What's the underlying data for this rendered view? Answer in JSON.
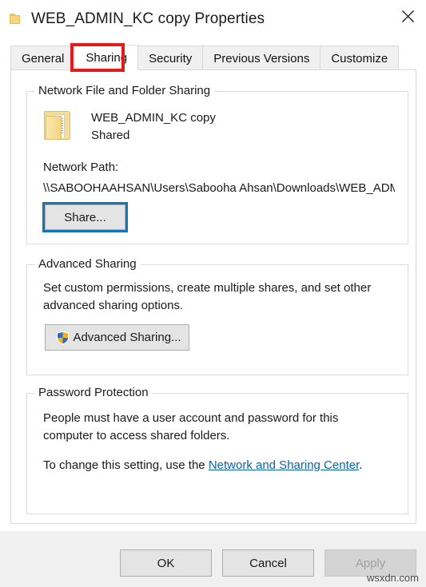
{
  "window": {
    "title": "WEB_ADMIN_KC copy Properties",
    "icon": "folder-icon",
    "close_label": "×"
  },
  "tabs": [
    {
      "label": "General",
      "active": false
    },
    {
      "label": "Sharing",
      "active": true
    },
    {
      "label": "Security",
      "active": false
    },
    {
      "label": "Previous Versions",
      "active": false
    },
    {
      "label": "Customize",
      "active": false
    }
  ],
  "annotation": {
    "target": "Sharing",
    "color": "#e01b1b"
  },
  "network_sharing": {
    "group_title": "Network File and Folder Sharing",
    "folder_name": "WEB_ADMIN_KC copy",
    "share_state": "Shared",
    "network_path_label": "Network Path:",
    "network_path_value": "\\\\SABOOHAAHSAN\\Users\\Sabooha Ahsan\\Downloads\\WEB_ADMIN_KC copy",
    "share_button": "Share..."
  },
  "advanced_sharing": {
    "group_title": "Advanced Sharing",
    "description": "Set custom permissions, create multiple shares, and set other advanced sharing options.",
    "button_label": "Advanced Sharing...",
    "button_icon": "uac-shield-icon"
  },
  "password_protection": {
    "group_title": "Password Protection",
    "description": "People must have a user account and password for this computer to access shared folders.",
    "change_prefix": "To change this setting, use the ",
    "link_label": "Network and Sharing Center",
    "change_suffix": "."
  },
  "footer": {
    "ok_label": "OK",
    "cancel_label": "Cancel",
    "apply_label": "Apply",
    "apply_disabled": true
  },
  "watermark": "wsxdn.com",
  "colors": {
    "accent_focus": "#1276b8",
    "link": "#0a63a8",
    "annotation_red": "#e01b1b",
    "folder_yellow": "#f5d67c",
    "footer_bg": "#f0f0f0"
  }
}
